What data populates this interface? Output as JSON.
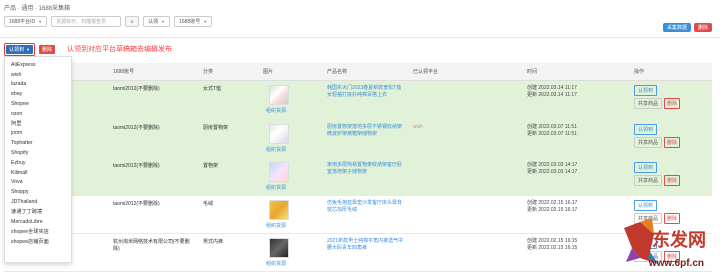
{
  "breadcrumb": "产品 · 通用 · 1688采集箱",
  "filters": {
    "source": "1688平台ID",
    "search_placeholder": "货源标示、扫描报告员",
    "claim": "认领",
    "account": "1688账号"
  },
  "top_buttons": {
    "collect": "采集数据",
    "delete": "删除"
  },
  "actions": {
    "claim": "认领到",
    "delete": "删除"
  },
  "annotation": "认领到对应平台草稿箱去编辑发布",
  "table": {
    "headers": [
      "1688账号",
      "分类",
      "图片",
      "产品名称",
      "已认领平台",
      "时间",
      "操作"
    ],
    "rows": [
      {
        "account": "taomi2012(不要删除)",
        "category": "女式T恤",
        "link": "组织货源",
        "name": "韩国东大门2023春夏新款宽松T恤女短袖打底衫纯棉百搭上衣",
        "platform": "",
        "time1": "创建 2022.03.14 11:17",
        "time2": "更新 2022.03.14 11:17",
        "claim": "认领到",
        "share": "共享商品",
        "del": "删除",
        "green": true
      },
      {
        "account": "taomi2012(不要删除)",
        "category": "厨房置物架",
        "link": "组织货源",
        "name": "厨房置物架落地多层不锈钢收纳架微波炉架烤箱架储物架",
        "platform": "wish",
        "time1": "创建 2022.03.07 11:51",
        "time2": "更新 2022.03.07 11:51",
        "claim": "认领到",
        "share": "共享商品",
        "del": "删除",
        "green": true
      },
      {
        "account": "taomi2012(不要删除)",
        "category": "置物架",
        "link": "组织货源",
        "name": "家用多层简易置物架收纳架客厅卧室落地架子储物架",
        "platform": "",
        "time1": "创建 2022.03.03 14:17",
        "time2": "更新 2022.03.03 14:17",
        "claim": "认领到",
        "share": "共享商品",
        "del": "删除",
        "green": true
      },
      {
        "account": "taomi2012(不要删除)",
        "category": "毛绒",
        "link": "组织货源",
        "name": "仿兔毛抱枕靠垫沙发客厅床头靠背枕芯加厚毛绒",
        "platform": "",
        "time1": "创建 2022.02.15 16:17",
        "time2": "更新 2022.02.15 16:17",
        "claim": "认领到",
        "share": "共享商品",
        "del": "删除",
        "green": false
      },
      {
        "account": "杭州淘米网络技术有限公司(不要删除)",
        "category": "男式内裤",
        "link": "组织货源",
        "name": "2021新款男士纯棉平角内裤透气中腰大码青年四角裤",
        "platform": "",
        "time1": "创建 2022.02.15 16:15",
        "time2": "更新 2022.02.15 16:15",
        "claim": "认领到",
        "share": "共享商品",
        "del": "删除",
        "green": false
      }
    ]
  },
  "dropdown": [
    "AliExpress",
    "wish",
    "lazada",
    "ebay",
    "Shopee",
    "ozon",
    "阿里",
    "joom",
    "Tophatter",
    "Shopify",
    "Ezbuy",
    "Kilimall",
    "Vova",
    "Shoppy",
    "JDThailand",
    "速通丁丁跨境",
    "MercadoLibre",
    "shopee全球买店",
    "shopee店铺页面"
  ],
  "watermark": {
    "title": "东发网",
    "site": "www.6pf.cn"
  }
}
